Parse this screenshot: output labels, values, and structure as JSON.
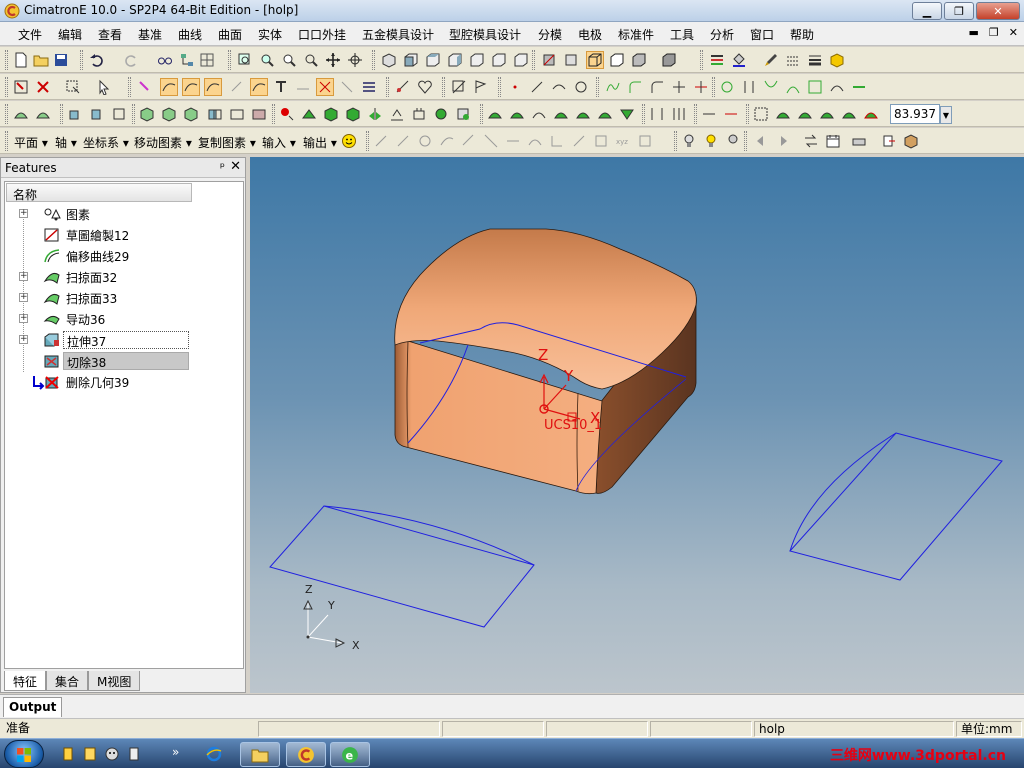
{
  "window": {
    "title": "CimatronE 10.0 - SP2P4 64-Bit Edition - [holp]"
  },
  "menu": {
    "items": [
      "文件",
      "编辑",
      "查看",
      "基准",
      "曲线",
      "曲面",
      "实体",
      "口口外挂",
      "五金模具设计",
      "型腔模具设计",
      "分模",
      "电极",
      "标准件",
      "工具",
      "分析",
      "窗口",
      "帮助"
    ]
  },
  "toolbar": {
    "zoom_value": "83.937",
    "text_menus": [
      "平面",
      "轴",
      "坐标系",
      "移动图素",
      "复制图素",
      "输入",
      "输出"
    ]
  },
  "panel": {
    "title": "Features",
    "pin": "ᵖ",
    "column_header": "名称",
    "tree": [
      {
        "label": "图素",
        "expandable": true
      },
      {
        "label": "草圖繪製12",
        "expandable": false
      },
      {
        "label": "偏移曲线29",
        "expandable": false
      },
      {
        "label": "扫掠面32",
        "expandable": true
      },
      {
        "label": "扫掠面33",
        "expandable": true
      },
      {
        "label": "导动36",
        "expandable": true
      },
      {
        "label": "拉伸37",
        "expandable": true
      },
      {
        "label": "切除38",
        "expandable": false
      },
      {
        "label": "删除几何39",
        "expandable": false
      }
    ],
    "tabs": [
      "特征",
      "集合",
      "M视图"
    ]
  },
  "viewport": {
    "ucs_label": "UCS10_1",
    "axis_z": "Z",
    "axis_y": "Y",
    "axis_x": "X",
    "model_color": "#e8a57a",
    "curve_color": "#2020e0"
  },
  "output": {
    "tab": "Output"
  },
  "status": {
    "ready": "准备",
    "file": "holp",
    "unit": "单位:mm"
  },
  "taskbar": {
    "watermark": "三维网www.3dportal.cn"
  }
}
